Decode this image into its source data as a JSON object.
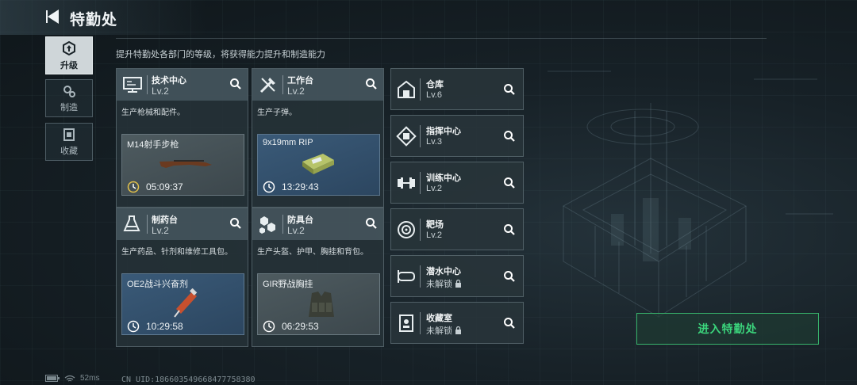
{
  "header": {
    "title": "特勤处"
  },
  "sidebar": {
    "tabs": [
      {
        "label": "升级",
        "active": true
      },
      {
        "label": "制造",
        "active": false
      },
      {
        "label": "收藏",
        "active": false
      }
    ]
  },
  "subtitle": "提升特勤处各部门的等级，将获得能力提升和制造能力",
  "cards": [
    {
      "name": "技术中心",
      "level": "Lv.2",
      "desc": "生产枪械和配件。",
      "item": "M14射手步枪",
      "time": "05:09:37",
      "icon": "tech-center-icon"
    },
    {
      "name": "工作台",
      "level": "Lv.2",
      "desc": "生产子弹。",
      "item": "9x19mm RIP",
      "time": "13:29:43",
      "icon": "workbench-icon"
    },
    {
      "name": "制药台",
      "level": "Lv.2",
      "desc": "生产药品、针剂和维修工具包。",
      "item": "OE2战斗兴奋剂",
      "time": "10:29:58",
      "icon": "pharmacy-icon"
    },
    {
      "name": "防具台",
      "level": "Lv.2",
      "desc": "生产头盔、护甲、胸挂和背包。",
      "item": "GIR野战胸挂",
      "time": "06:29:53",
      "icon": "armor-bench-icon"
    }
  ],
  "facilities": [
    {
      "name": "仓库",
      "level": "Lv.6",
      "locked": false,
      "icon": "warehouse-icon"
    },
    {
      "name": "指挥中心",
      "level": "Lv.3",
      "locked": false,
      "icon": "command-center-icon"
    },
    {
      "name": "训练中心",
      "level": "Lv.2",
      "locked": false,
      "icon": "training-center-icon"
    },
    {
      "name": "靶场",
      "level": "Lv.2",
      "locked": false,
      "icon": "shooting-range-icon"
    },
    {
      "name": "潜水中心",
      "level": "未解锁",
      "locked": true,
      "icon": "diving-center-icon"
    },
    {
      "name": "收藏室",
      "level": "未解锁",
      "locked": true,
      "icon": "collection-room-icon"
    }
  ],
  "enter_button": "进入特勤处",
  "status": {
    "ping": "52ms",
    "uid": "CN UID:18660354966847775838​0"
  },
  "colors": {
    "accent_green": "#3bd57c",
    "card_bg": "#263238"
  }
}
